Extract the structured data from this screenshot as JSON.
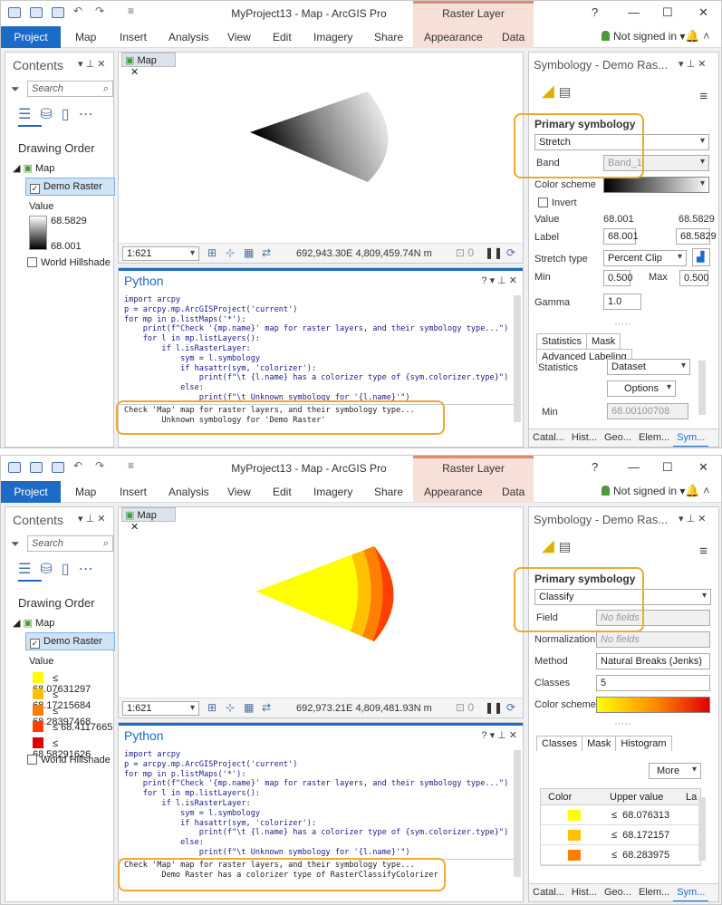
{
  "app": {
    "title": "MyProject13 - Map - ArcGIS Pro",
    "contextual_tab": "Raster Layer",
    "window_controls": [
      "?",
      "—",
      "☐",
      "✕"
    ]
  },
  "ribbon": {
    "tabs": [
      "Project",
      "Map",
      "Insert",
      "Analysis",
      "View",
      "Edit",
      "Imagery",
      "Share",
      "Appearance",
      "Data"
    ],
    "signin": "Not signed in"
  },
  "contents": {
    "title": "Contents",
    "search_placeholder": "Search",
    "drawing_order": "Drawing Order",
    "map_node": "Map",
    "selected_layer": "Demo Raster",
    "value_header": "Value",
    "other_layer": "World Hillshade"
  },
  "map": {
    "tab_label": "Map"
  },
  "python": {
    "title": "Python",
    "code": "import arcpy\np = arcpy.mp.ArcGISProject('current')\nfor mp in p.listMaps('*'):\n    print(f\"Check '{mp.name}' map for raster layers, and their symbology type...\")\n    for l in mp.listLayers():\n        if l.isRasterLayer:\n            sym = l.symbology\n            if hasattr(sym, 'colorizer'):\n                print(f\"\\t {l.name} has a colorizer type of {sym.colorizer.type}\")\n            else:\n                print(f\"\\t Unknown symbology for '{l.name}'\")"
  },
  "top": {
    "legend_high": "68.5829",
    "legend_low": "68.001",
    "scale": "1:621",
    "coords": "692,943.30E 4,809,459.74N m",
    "selection_count": "0",
    "output": "Check 'Map' map for raster layers, and their symbology type...\n        Unknown symbology for 'Demo Raster'",
    "sym": {
      "title": "Symbology - Demo Ras...",
      "primary": "Primary symbology",
      "method": "Stretch",
      "band_label": "Band",
      "band": "Band_1",
      "color_scheme_label": "Color scheme",
      "invert": "Invert",
      "value_label": "Value",
      "value_lo": "68.001",
      "value_hi": "68.5829",
      "label_label": "Label",
      "label_lo": "68.001",
      "label_hi": "68.5829",
      "stretch_label": "Stretch type",
      "stretch": "Percent Clip",
      "min_label": "Min",
      "min": "0.500",
      "max_label": "Max",
      "max": "0.500",
      "gamma_label": "Gamma",
      "gamma": "1.0",
      "tabs": [
        "Statistics",
        "Mask",
        "Advanced Labeling"
      ],
      "stats_label": "Statistics",
      "stats": "Dataset",
      "options": "Options",
      "min2_label": "Min",
      "min2": "68.00100708"
    }
  },
  "bottom": {
    "legend": [
      {
        "label": "≤ 68.07631297",
        "color": "#ffff00"
      },
      {
        "label": "≤ 68.17215684",
        "color": "#ffc000"
      },
      {
        "label": "≤ 68.28397468",
        "color": "#ff8000"
      },
      {
        "label": "≤ 68.4117665",
        "color": "#ff4000"
      },
      {
        "label": "≤ 68.58291626",
        "color": "#e00000"
      }
    ],
    "scale": "1:621",
    "coords": "692,973.21E 4,809,481.93N m",
    "selection_count": "0",
    "output": "Check 'Map' map for raster layers, and their symbology type...\n        Demo Raster has a colorizer type of RasterClassifyColorizer",
    "sym": {
      "title": "Symbology - Demo Ras...",
      "primary": "Primary symbology",
      "method": "Classify",
      "field_label": "Field",
      "field": "No fields",
      "norm_label": "Normalization",
      "norm": "No fields",
      "method_label": "Method",
      "method_val": "Natural Breaks (Jenks)",
      "classes_label": "Classes",
      "classes": "5",
      "color_scheme_label": "Color scheme",
      "tabs": [
        "Classes",
        "Mask",
        "Histogram"
      ],
      "more": "More",
      "col_color": "Color",
      "col_upper": "Upper value",
      "col_la": "La",
      "rows": [
        {
          "color": "#ffff00",
          "value": "68.076313"
        },
        {
          "color": "#ffc000",
          "value": "68.172157"
        },
        {
          "color": "#ff8000",
          "value": "68.283975"
        }
      ],
      "le": "≤"
    }
  },
  "bottom_tabs": [
    "Catal...",
    "Hist...",
    "Geo...",
    "Elem...",
    "Sym..."
  ]
}
